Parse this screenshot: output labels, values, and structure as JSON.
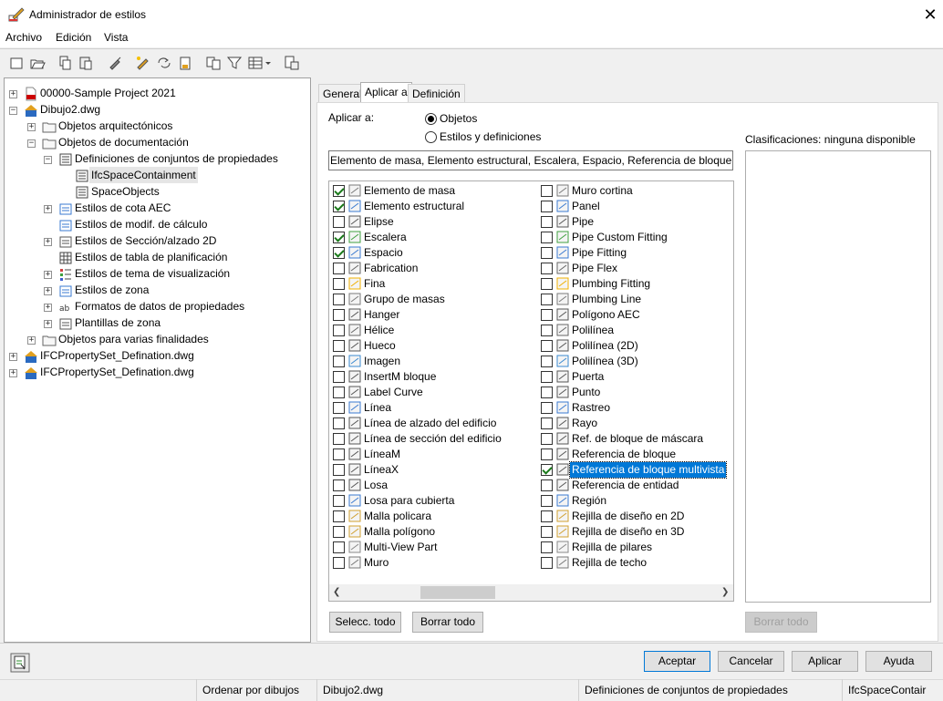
{
  "window": {
    "title": "Administrador de estilos",
    "close_glyph": "✕"
  },
  "menu": [
    {
      "label": "Archivo"
    },
    {
      "label": "Edición"
    },
    {
      "label": "Vista"
    }
  ],
  "toolbar_icons": [
    "new-icon",
    "open-icon",
    "copy-icon",
    "paste-icon",
    "purge-icon",
    "edit-icon",
    "sort-icon",
    "import-icon",
    "compare-icon",
    "filter-icon",
    "view-icon",
    "toggle-icon"
  ],
  "tree": [
    {
      "label": "00000-Sample Project 2021",
      "icon": "pdf-project-icon"
    },
    {
      "label": "Dibujo2.dwg",
      "icon": "drawing-icon"
    },
    {
      "label": "Objetos arquitectónicos",
      "icon": "folder-icon"
    },
    {
      "label": "Objetos de documentación",
      "icon": "folder-icon"
    },
    {
      "label": "Definiciones de conjuntos de propiedades",
      "icon": "propset-icon"
    },
    {
      "label": "IfcSpaceContainment",
      "icon": "propset-item-icon"
    },
    {
      "label": "SpaceObjects",
      "icon": "propset-item-icon"
    },
    {
      "label": "Estilos de cota AEC",
      "icon": "dimension-icon"
    },
    {
      "label": "Estilos de modif. de cálculo",
      "icon": "calc-icon"
    },
    {
      "label": "Estilos de Sección/alzado 2D",
      "icon": "section-icon"
    },
    {
      "label": "Estilos de tabla de planificación",
      "icon": "table-icon"
    },
    {
      "label": "Estilos de tema de visualización",
      "icon": "theme-icon"
    },
    {
      "label": "Estilos de zona",
      "icon": "zone-icon"
    },
    {
      "label": "Formatos de datos de propiedades",
      "icon": "format-icon"
    },
    {
      "label": "Plantillas de zona",
      "icon": "zone-template-icon"
    },
    {
      "label": "Objetos para varias finalidades",
      "icon": "folder-icon"
    },
    {
      "label": "IFCPropertySet_Defination.dwg",
      "icon": "drawing-locked-icon"
    },
    {
      "label": "IFCPropertySet_Defination.dwg",
      "icon": "drawing-locked-icon"
    }
  ],
  "tabs": [
    {
      "label": "General"
    },
    {
      "label": "Aplicar a"
    },
    {
      "label": "Definición"
    }
  ],
  "apply": {
    "label": "Aplicar a:",
    "option_objects": "Objetos",
    "option_styles": "Estilos y definiciones",
    "selected": "Objetos",
    "field_value": "Elemento de masa, Elemento estructural, Escalera, Espacio, Referencia de bloque multivista"
  },
  "classifications_label": "Clasificaciones: ninguna disponible",
  "list_left": [
    {
      "label": "Elemento de masa",
      "checked": true
    },
    {
      "label": "Elemento estructural",
      "checked": true
    },
    {
      "label": "Elipse",
      "checked": false
    },
    {
      "label": "Escalera",
      "checked": true
    },
    {
      "label": "Espacio",
      "checked": true
    },
    {
      "label": "Fabrication",
      "checked": false
    },
    {
      "label": "Fina",
      "checked": false
    },
    {
      "label": "Grupo de masas",
      "checked": false
    },
    {
      "label": "Hanger",
      "checked": false
    },
    {
      "label": "Hélice",
      "checked": false
    },
    {
      "label": "Hueco",
      "checked": false
    },
    {
      "label": "Imagen",
      "checked": false
    },
    {
      "label": "InsertM bloque",
      "checked": false
    },
    {
      "label": "Label Curve",
      "checked": false
    },
    {
      "label": "Línea",
      "checked": false
    },
    {
      "label": "Línea de alzado del edificio",
      "checked": false
    },
    {
      "label": "Línea de sección del edificio",
      "checked": false
    },
    {
      "label": "LíneaM",
      "checked": false
    },
    {
      "label": "LíneaX",
      "checked": false
    },
    {
      "label": "Losa",
      "checked": false
    },
    {
      "label": "Losa para cubierta",
      "checked": false
    },
    {
      "label": "Malla policara",
      "checked": false
    },
    {
      "label": "Malla polígono",
      "checked": false
    },
    {
      "label": "Multi-View Part",
      "checked": false
    },
    {
      "label": "Muro",
      "checked": false
    }
  ],
  "list_right": [
    {
      "label": "Muro cortina",
      "checked": false
    },
    {
      "label": "Panel",
      "checked": false
    },
    {
      "label": "Pipe",
      "checked": false
    },
    {
      "label": "Pipe Custom Fitting",
      "checked": false
    },
    {
      "label": "Pipe Fitting",
      "checked": false
    },
    {
      "label": "Pipe Flex",
      "checked": false
    },
    {
      "label": "Plumbing Fitting",
      "checked": false
    },
    {
      "label": "Plumbing Line",
      "checked": false
    },
    {
      "label": "Polígono AEC",
      "checked": false
    },
    {
      "label": "Polilínea",
      "checked": false
    },
    {
      "label": "Polilínea (2D)",
      "checked": false
    },
    {
      "label": "Polilínea (3D)",
      "checked": false
    },
    {
      "label": "Puerta",
      "checked": false
    },
    {
      "label": "Punto",
      "checked": false
    },
    {
      "label": "Rastreo",
      "checked": false
    },
    {
      "label": "Rayo",
      "checked": false
    },
    {
      "label": "Ref. de bloque de máscara",
      "checked": false
    },
    {
      "label": "Referencia de bloque",
      "checked": false
    },
    {
      "label": "Referencia de bloque multivista",
      "checked": true,
      "selected": true
    },
    {
      "label": "Referencia de entidad",
      "checked": false
    },
    {
      "label": "Región",
      "checked": false
    },
    {
      "label": "Rejilla de diseño en 2D",
      "checked": false
    },
    {
      "label": "Rejilla de diseño en 3D",
      "checked": false
    },
    {
      "label": "Rejilla de pilares",
      "checked": false
    },
    {
      "label": "Rejilla de techo",
      "checked": false
    }
  ],
  "buttons": {
    "select_all": "Selecc. todo",
    "clear_all": "Borrar todo",
    "class_clear_all": "Borrar todo",
    "ok": "Aceptar",
    "cancel": "Cancelar",
    "apply": "Aplicar",
    "help": "Ayuda"
  },
  "status": {
    "sort": "Ordenar por dibujos",
    "drawing": "Dibujo2.dwg",
    "category": "Definiciones de conjuntos de propiedades",
    "item": "IfcSpaceContair"
  },
  "colors": {
    "selection": "#0078d7",
    "check": "#1a7a1a"
  }
}
